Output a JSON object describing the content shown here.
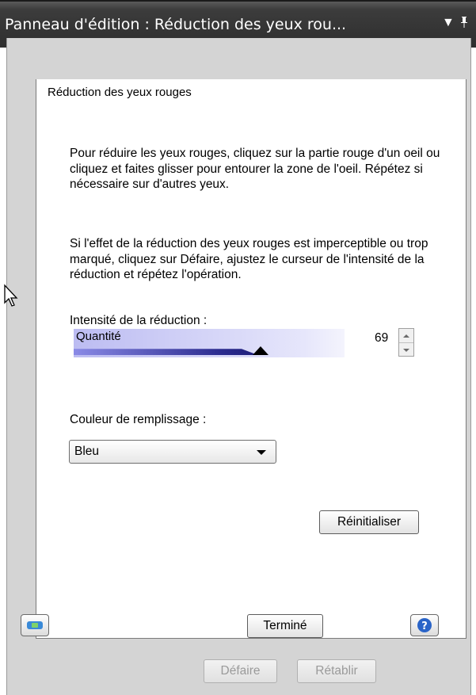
{
  "window": {
    "title": "Panneau d'édition : Réduction des yeux rou...",
    "menu_glyph": "▼",
    "pin_glyph": "ᵽ"
  },
  "panel": {
    "heading": "Réduction des yeux rouges",
    "paragraph1": "Pour réduire les yeux rouges, cliquez sur la partie rouge d'un oeil ou cliquez et faites glisser pour entourer la zone de l'oeil. Répétez si nécessaire sur d'autres yeux.",
    "paragraph2": "Si l'effet de la réduction des yeux rouges est imperceptible ou trop marqué, cliquez sur Défaire, ajustez le curseur de l'intensité de la réduction et répétez l'opération.",
    "intensity_label": "Intensité de la réduction :",
    "slider": {
      "label": "Quantité",
      "value": "69",
      "min": 0,
      "max": 100
    },
    "fill_label": "Couleur de remplissage :",
    "fill_select": {
      "value": "Bleu"
    },
    "reset_button": "Réinitialiser"
  },
  "footer": {
    "done_button": "Terminé",
    "undo_button": "Défaire",
    "redo_button": "Rétablir"
  },
  "colors": {
    "title_bar": "#3c3c3c",
    "slider_dark": "#06064a",
    "slider_light": "#bcbcf2",
    "help_icon": "#2a64c8",
    "left_icon": "#3a8ad8"
  }
}
